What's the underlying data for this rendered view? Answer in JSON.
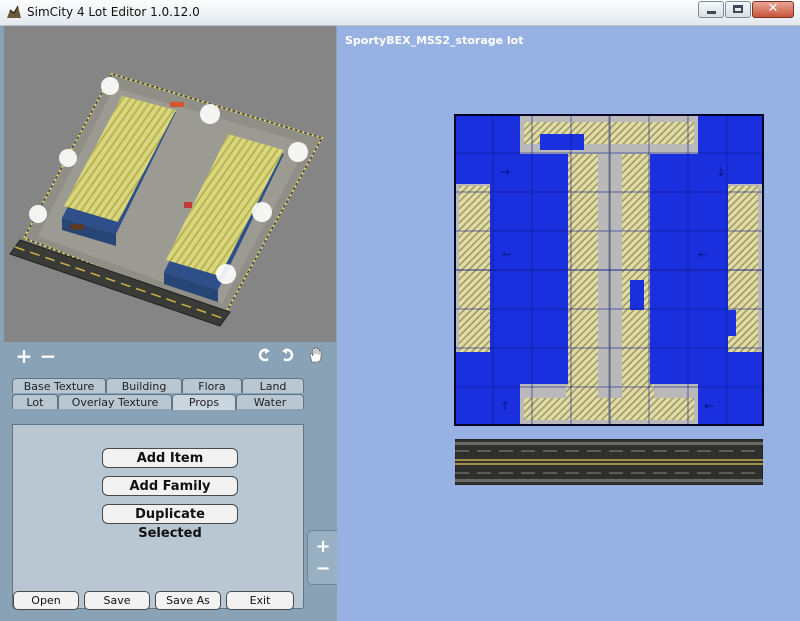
{
  "window": {
    "title": "SimCity 4 Lot Editor 1.0.12.0"
  },
  "toolbar": {
    "add_symbol": "+",
    "remove_symbol": "−",
    "rotate_left_icon": "rotate-left-icon",
    "rotate_right_icon": "rotate-right-icon",
    "pan_icon": "hand-icon"
  },
  "tabs": {
    "row_top": [
      "Base Texture",
      "Building",
      "Flora",
      "Land"
    ],
    "row_bottom": [
      "Lot",
      "Overlay Texture",
      "Props",
      "Water"
    ],
    "active": "Props"
  },
  "props_panel": {
    "add_item": "Add Item",
    "add_family": "Add Family",
    "duplicate_selected": "Duplicate Selected"
  },
  "bottom_buttons": {
    "open": "Open",
    "save": "Save",
    "save_as": "Save As",
    "exit": "Exit"
  },
  "zoom": {
    "in": "+",
    "out": "−"
  },
  "lot_view": {
    "name": "SportyBEX_MSS2_storage lot"
  },
  "colors": {
    "canvas_background": "#97b1e3",
    "footprint_blue": "#1a2fdd",
    "pavement_gray": "#b9b9b9",
    "hatch_yellow": "#e2dca0",
    "preview_background": "#858585"
  }
}
